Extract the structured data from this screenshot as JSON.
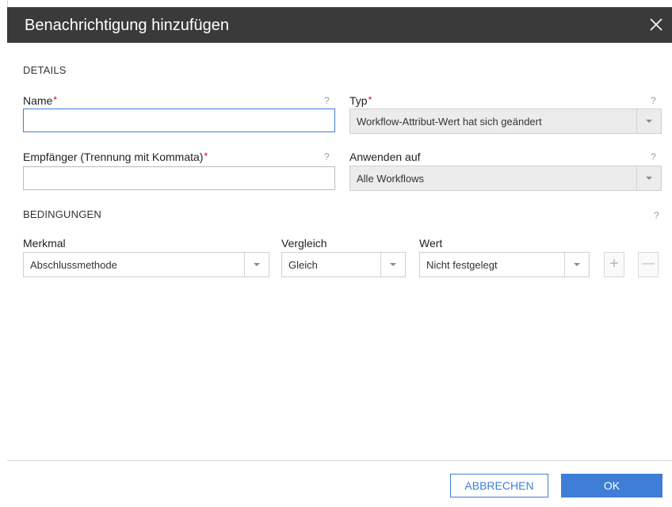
{
  "dialog": {
    "title": "Benachrichtigung hinzufügen",
    "close_icon": "close-icon"
  },
  "details": {
    "section_label": "DETAILS",
    "help_mark": "?",
    "required_mark": "*",
    "name": {
      "label": "Name",
      "value": ""
    },
    "typ": {
      "label": "Typ",
      "value": "Workflow-Attribut-Wert hat sich geändert"
    },
    "empfaenger": {
      "label": "Empfänger (Trennung mit Kommata)",
      "value": ""
    },
    "anwenden_auf": {
      "label": "Anwenden auf",
      "value": "Alle Workflows"
    }
  },
  "bedingungen": {
    "section_label": "BEDINGUNGEN",
    "merkmal": {
      "label": "Merkmal",
      "value": "Abschlussmethode"
    },
    "vergleich": {
      "label": "Vergleich",
      "value": "Gleich"
    },
    "wert": {
      "label": "Wert",
      "value": "Nicht festgelegt"
    },
    "add_symbol": "+",
    "remove_symbol": "—"
  },
  "footer": {
    "cancel_label": "ABBRECHEN",
    "ok_label": "OK"
  },
  "colors": {
    "header_bg": "#3a3a3a",
    "accent": "#3f7ed6",
    "required": "#d0021b"
  }
}
